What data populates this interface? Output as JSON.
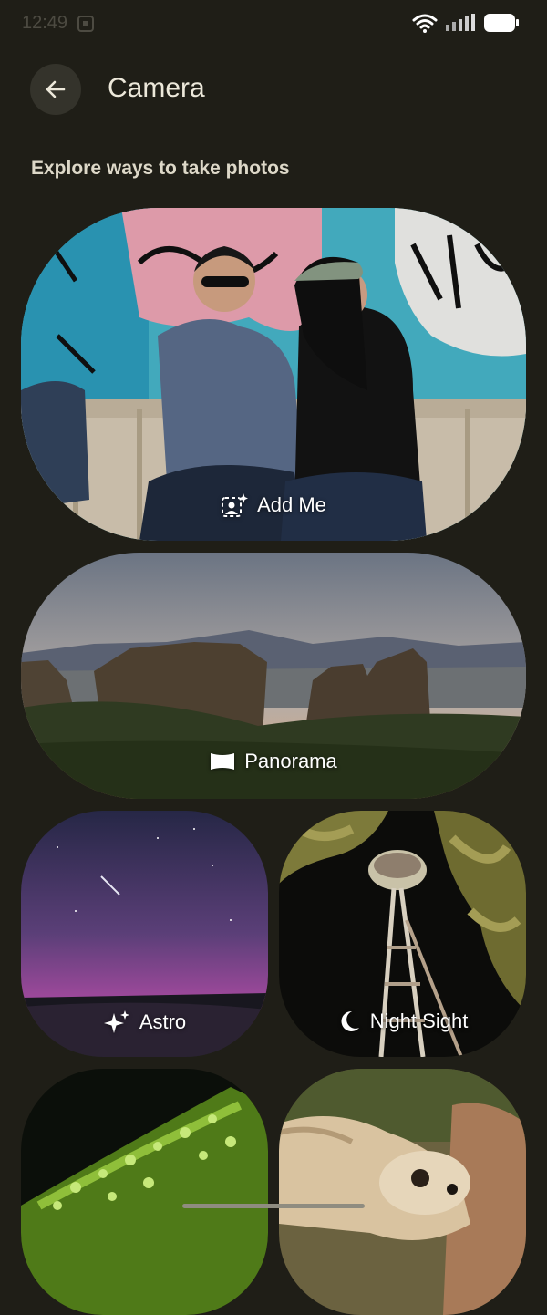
{
  "status_bar": {
    "time": "12:49",
    "icons": [
      "screen-cast-icon",
      "wifi-icon",
      "signal-icon",
      "battery-icon"
    ]
  },
  "header": {
    "title": "Camera",
    "back_icon": "arrow-left-icon"
  },
  "section": {
    "title": "Explore ways to take photos"
  },
  "cards": [
    {
      "label": "Add Me",
      "icon": "add-me-icon"
    },
    {
      "label": "Panorama",
      "icon": "panorama-icon"
    },
    {
      "label": "Astro",
      "icon": "sparkle-icon"
    },
    {
      "label": "Night Sight",
      "icon": "moon-icon"
    },
    {
      "label": "",
      "icon": ""
    },
    {
      "label": "",
      "icon": ""
    }
  ],
  "colors": {
    "background": "#1f1e17",
    "back_button": "#34332b",
    "title_text": "#ece8da"
  }
}
